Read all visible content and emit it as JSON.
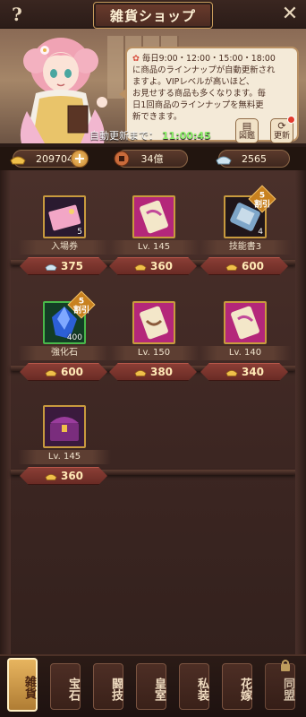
{
  "header": {
    "title": "雑貨ショップ",
    "help_label": "?",
    "close_label": "✕"
  },
  "banner": {
    "speech_lines": [
      "毎日9:00・12:00・15:00・18:00",
      "に商品のラインナップが自動更新され",
      "ますよ。VIPレベルが高いほど、",
      "お見せする商品も多くなります。毎",
      "日1回商品のラインナップを無料更",
      "新できます。"
    ],
    "refresh_label": "自動更新まで：",
    "refresh_timer": "11:00:45",
    "catalog_label": "図鑑",
    "refresh_button_label": "更新"
  },
  "currency": {
    "gold": "209704",
    "coin": "34億",
    "gem": "2565"
  },
  "items": [
    {
      "name": "入場券",
      "qty": "5",
      "price": "375",
      "currency": "gem",
      "icon": "ticket-icon",
      "discount": ""
    },
    {
      "name": "Lv. 145",
      "qty": "",
      "price": "360",
      "currency": "gold",
      "icon": "scroll-icon",
      "discount": ""
    },
    {
      "name": "技能書3",
      "qty": "4",
      "price": "600",
      "currency": "gold",
      "icon": "skill-book-icon",
      "discount": "5\n割引"
    },
    {
      "name": "強化石",
      "qty": "400",
      "price": "600",
      "currency": "gold",
      "icon": "crystal-icon",
      "discount": "5\n割引"
    },
    {
      "name": "Lv. 150",
      "qty": "",
      "price": "380",
      "currency": "gold",
      "icon": "scroll-icon",
      "discount": ""
    },
    {
      "name": "Lv. 140",
      "qty": "",
      "price": "340",
      "currency": "gold",
      "icon": "scroll-icon",
      "discount": ""
    },
    {
      "name": "Lv. 145",
      "qty": "",
      "price": "360",
      "currency": "gold",
      "icon": "chest-icon",
      "discount": ""
    }
  ],
  "tabs": [
    {
      "label": "雑貨",
      "active": true
    },
    {
      "label": "宝石",
      "active": false
    },
    {
      "label": "闘技",
      "active": false
    },
    {
      "label": "皇室",
      "active": false
    },
    {
      "label": "私装",
      "active": false
    },
    {
      "label": "花嫁",
      "active": false
    },
    {
      "label": "同盟",
      "active": false,
      "locked": true
    }
  ],
  "colors": {
    "accent_gold": "#e7b55f",
    "timer_green": "#8ef26a",
    "vip_red": "#b3261e"
  }
}
